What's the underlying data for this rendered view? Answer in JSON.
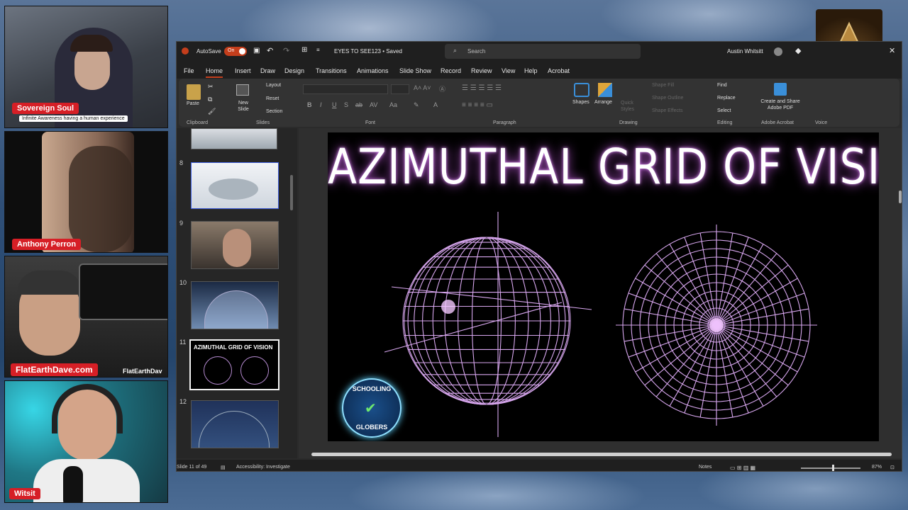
{
  "cams": [
    {
      "name": "Sovereign Soul",
      "tagline": "Infinite Awareness having a human experience"
    },
    {
      "name": "Anthony Perron"
    },
    {
      "name": "FlatEarthDave.com",
      "watermark": "FlatEarthDav"
    },
    {
      "name": "Witsit"
    }
  ],
  "titlebar": {
    "autosave": "AutoSave",
    "autosave_state": "On",
    "doc_title": "EYES TO SEE123 • Saved",
    "search_placeholder": "Search",
    "user": "Austin Whitsitt"
  },
  "menu": [
    "File",
    "Home",
    "Insert",
    "Draw",
    "Design",
    "Transitions",
    "Animations",
    "Slide Show",
    "Record",
    "Review",
    "View",
    "Help",
    "Acrobat"
  ],
  "ribbon": {
    "clipboard": {
      "paste": "Paste",
      "label": "Clipboard"
    },
    "slides": {
      "new_slide": "New Slide",
      "layout": "Layout",
      "reset": "Reset",
      "section": "Section",
      "label": "Slides"
    },
    "font": {
      "label": "Font"
    },
    "paragraph": {
      "label": "Paragraph"
    },
    "drawing": {
      "shapes": "Shapes",
      "arrange": "Arrange",
      "quick_styles": "Quick Styles",
      "shape_fill": "Shape Fill",
      "shape_outline": "Shape Outline",
      "shape_effects": "Shape Effects",
      "label": "Drawing"
    },
    "editing": {
      "find": "Find",
      "replace": "Replace",
      "select": "Select",
      "label": "Editing"
    },
    "adobe": {
      "create_share": "Create and Share Adobe PDF",
      "label": "Adobe Acrobat"
    },
    "voice": {
      "label": "Voice"
    }
  },
  "thumbnails": [
    {
      "num": "8"
    },
    {
      "num": "9"
    },
    {
      "num": "10"
    },
    {
      "num": "11",
      "title": "AZIMUTHAL GRID OF VISION",
      "selected": true
    },
    {
      "num": "12"
    }
  ],
  "slide": {
    "title": "AZIMUTHAL GRID OF VISION",
    "logo_top": "SCHOOLING",
    "logo_bottom": "GLOBERS"
  },
  "status": {
    "slide_count": "Slide 11 of 49",
    "accessibility": "Accessibility: Investigate",
    "notes": "Notes",
    "zoom": "87%"
  },
  "colors": {
    "accent": "#c43e1c",
    "grid": "#d7a6ee",
    "label_red": "#d61f26"
  }
}
